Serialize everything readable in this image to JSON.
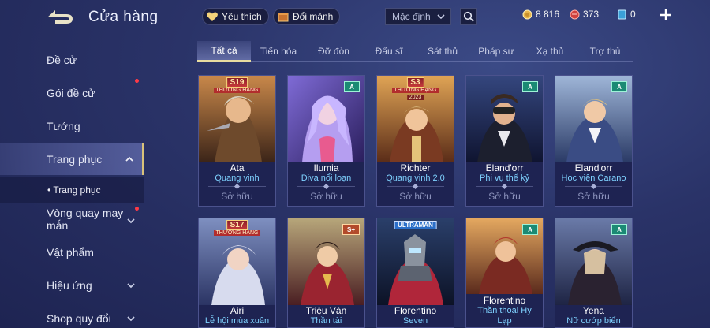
{
  "header": {
    "title": "Cửa hàng",
    "favorites_label": "Yêu thích",
    "exchange_label": "Đổi mảnh",
    "sort_value": "Mặc định",
    "gold_amount": "8 816",
    "red_gem_amount": "373",
    "voucher_amount": "0"
  },
  "sidebar": {
    "items": [
      {
        "label": "Đề cử"
      },
      {
        "label": "Gói đề cử"
      },
      {
        "label": "Tướng"
      },
      {
        "label": "Trang phục"
      },
      {
        "label": "• Trang phục"
      },
      {
        "label": "Vòng quay may mắn"
      },
      {
        "label": "Vật phẩm"
      },
      {
        "label": "Hiệu ứng"
      },
      {
        "label": "Shop quy đổi"
      }
    ]
  },
  "tabs": [
    "Tất cả",
    "Tiến hóa",
    "Đỡ đòn",
    "Đấu sĩ",
    "Sát thủ",
    "Pháp sư",
    "Xạ thủ",
    "Trợ thủ"
  ],
  "cards": [
    {
      "hero": "Ata",
      "skin": "Quang vinh",
      "status": "Sở hữu",
      "badge": "S19",
      "badge_sub": "THƯỜNG HẠNG",
      "badge_sub2": ""
    },
    {
      "hero": "Ilumia",
      "skin": "Diva nổi loạn",
      "status": "Sở hữu",
      "badge": "A",
      "badge_sub": "",
      "badge_sub2": ""
    },
    {
      "hero": "Richter",
      "skin": "Quang vinh 2.0",
      "status": "Sở hữu",
      "badge": "S3",
      "badge_sub": "THƯỜNG HẠNG",
      "badge_sub2": "2023"
    },
    {
      "hero": "Eland'orr",
      "skin": "Phi vụ thế kỷ",
      "status": "Sở hữu",
      "badge": "A",
      "badge_sub": "",
      "badge_sub2": ""
    },
    {
      "hero": "Eland'orr",
      "skin": "Học viện Carano",
      "status": "Sở hữu",
      "badge": "A",
      "badge_sub": "",
      "badge_sub2": ""
    },
    {
      "hero": "Airi",
      "skin": "Lễ hội mùa xuân",
      "status": "",
      "badge": "S17",
      "badge_sub": "THƯỜNG HẠNG",
      "badge_sub2": ""
    },
    {
      "hero": "Triệu Vân",
      "skin": "Thần tài",
      "status": "",
      "badge": "S+",
      "badge_sub": "",
      "badge_sub2": ""
    },
    {
      "hero": "Florentino",
      "skin": "Seven",
      "status": "",
      "badge": "ULTRAMAN",
      "badge_sub": "",
      "badge_sub2": ""
    },
    {
      "hero": "Florentino",
      "skin": "Thần thoại Hy Lạp",
      "status": "",
      "badge": "A",
      "badge_sub": "",
      "badge_sub2": ""
    },
    {
      "hero": "Yena",
      "skin": "Nữ cướp biển",
      "status": "",
      "badge": "A",
      "badge_sub": "",
      "badge_sub2": ""
    }
  ],
  "colors": {
    "background": "#2a3368",
    "accent_gold": "#d9c27a",
    "skin_name": "#7fd2ff",
    "notification": "#ff3a46"
  },
  "icons": [
    "back-arrow-icon",
    "heart-icon",
    "box-icon",
    "chevron-down-icon",
    "search-icon",
    "gold-coin-icon",
    "red-gem-icon",
    "voucher-icon",
    "plus-icon"
  ]
}
